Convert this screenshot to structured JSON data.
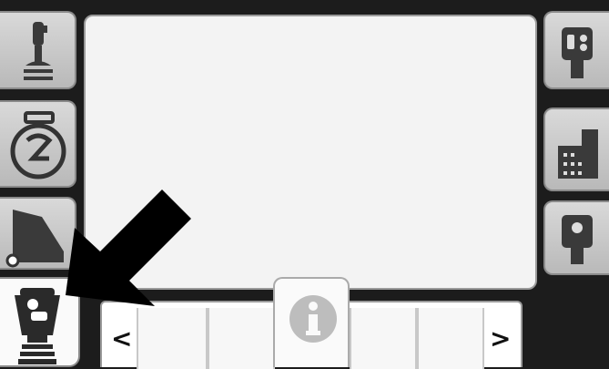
{
  "left_toolbar": {
    "items": [
      {
        "icon": "joystick-icon"
      },
      {
        "icon": "stopwatch-icon"
      },
      {
        "icon": "field-profile-icon"
      },
      {
        "icon": "handheld-controller-icon",
        "active": true
      }
    ]
  },
  "right_toolbar": {
    "items": [
      {
        "icon": "remote-control-icon"
      },
      {
        "icon": "building-icon"
      },
      {
        "icon": "sensor-icon"
      }
    ]
  },
  "bottom_bar": {
    "prev_label": "<",
    "next_label": ">",
    "info_icon": "info-icon"
  },
  "colors": {
    "background": "#1c1c1c",
    "button": "#c8c8c8",
    "screen": "#f3f3f3",
    "icon": "#333333"
  }
}
